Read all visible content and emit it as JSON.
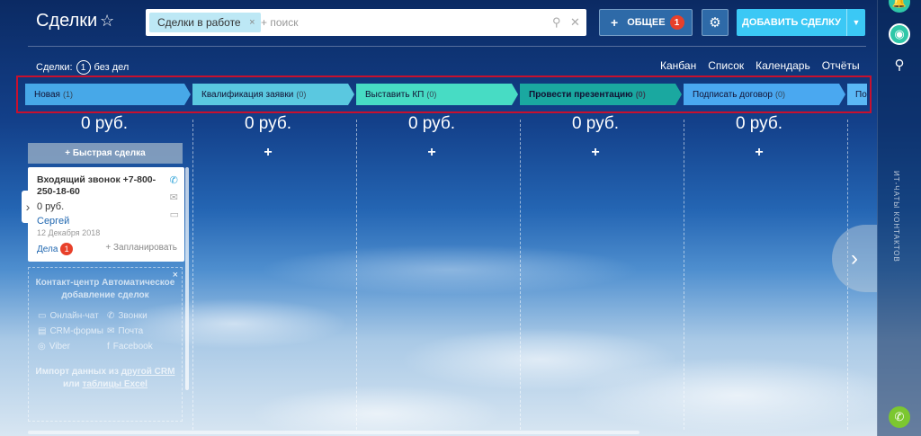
{
  "header": {
    "title": "Сделки",
    "search_chip": "Сделки в работе",
    "search_placeholder": "+ поиск",
    "common_label": "ОБЩЕЕ",
    "common_badge": "1",
    "add_label": "ДОБАВИТЬ СДЕЛКУ"
  },
  "subheader": {
    "prefix": "Сделки:",
    "count": "1",
    "suffix": "без дел"
  },
  "view_tabs": [
    "Канбан",
    "Список",
    "Календарь",
    "Отчёты"
  ],
  "active_view": "Канбан",
  "stages": [
    {
      "name": "Новая",
      "count": "(1)",
      "color": "#47a8e8"
    },
    {
      "name": "Квалификация заявки",
      "count": "(0)",
      "color": "#5ac8e0"
    },
    {
      "name": "Выставить КП",
      "count": "(0)",
      "color": "#47dcc4"
    },
    {
      "name": "Провести презентацию",
      "count": "(0)",
      "color": "#1aa8a0"
    },
    {
      "name": "Подписать договор",
      "count": "(0)",
      "color": "#4aa8f0"
    },
    {
      "name": "По",
      "count": "",
      "color": "#5bb8f5"
    }
  ],
  "columns": [
    {
      "sum": "0 руб."
    },
    {
      "sum": "0 руб.",
      "plus": "+"
    },
    {
      "sum": "0 руб.",
      "plus": "+"
    },
    {
      "sum": "0 руб.",
      "plus": "+"
    },
    {
      "sum": "0 руб.",
      "plus": "+"
    }
  ],
  "quick_deal": "+ Быстрая сделка",
  "card": {
    "title": "Входящий звонок +7-800-250-18-60",
    "sum": "0 руб.",
    "user": "Сергей",
    "date": "12 Декабря 2018",
    "tasks_label": "Дела",
    "tasks_badge": "1",
    "plan_label": "+ Запланировать"
  },
  "promo": {
    "title": "Контакт-центр Автоматическое добавление сделок",
    "items": [
      "Онлайн-чат",
      "Звонки",
      "CRM-формы",
      "Почта",
      "Viber",
      "Facebook"
    ],
    "foot_prefix": "Импорт данных из",
    "foot_link1": "другой CRM",
    "foot_mid": "или",
    "foot_link2": "таблицы Excel"
  },
  "right_panel": {
    "vertical_label": "ИТ-ЧАТЫ КОНТАКТОВ"
  },
  "colors": {
    "accent": "#3bc8f5",
    "badge": "#e8402a",
    "highlight_border": "#c8102e"
  }
}
